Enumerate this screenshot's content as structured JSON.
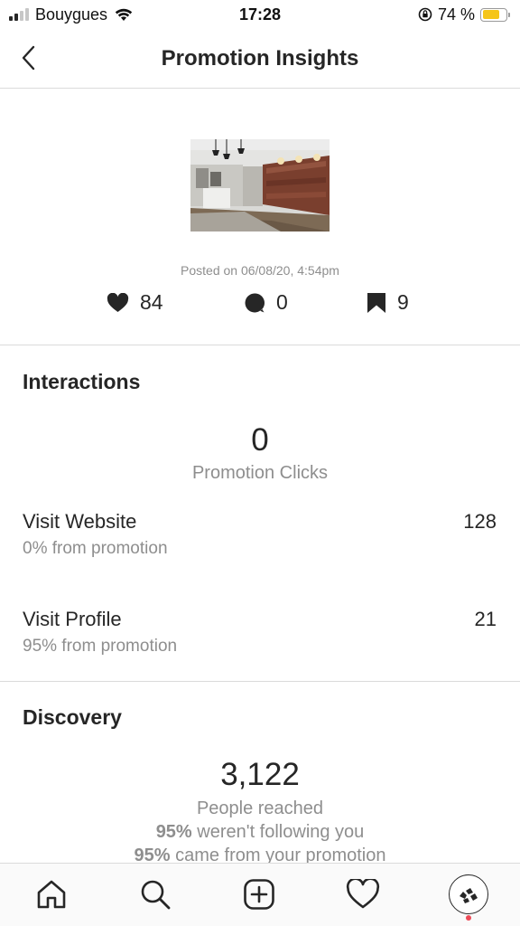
{
  "status_bar": {
    "carrier": "Bouygues",
    "time": "17:28",
    "battery_percent": "74 %",
    "battery_level": 0.74
  },
  "header": {
    "title": "Promotion Insights"
  },
  "post": {
    "posted_on": "Posted on 06/08/20, 4:54pm",
    "likes": "84",
    "comments": "0",
    "saves": "9"
  },
  "interactions": {
    "title": "Interactions",
    "promotion_clicks_value": "0",
    "promotion_clicks_label": "Promotion Clicks",
    "rows": [
      {
        "label": "Visit Website",
        "value": "128",
        "sub": "0% from promotion"
      },
      {
        "label": "Visit Profile",
        "value": "21",
        "sub": "95% from promotion"
      }
    ]
  },
  "discovery": {
    "title": "Discovery",
    "people_reached_value": "3,122",
    "people_reached_label": "People reached",
    "not_following_pct": "95%",
    "not_following_text": " weren't following you",
    "from_promotion_pct": "95%",
    "from_promotion_text": " came from your promotion"
  },
  "tab_bar": {
    "icons": [
      "home-icon",
      "search-icon",
      "add-post-icon",
      "activity-heart-icon",
      "profile-avatar"
    ]
  },
  "colors": {
    "text_primary": "#262626",
    "text_secondary": "#8e8e8e",
    "divider": "#dbdbdb",
    "battery": "#f5c518",
    "notification_dot": "#ed4956"
  }
}
